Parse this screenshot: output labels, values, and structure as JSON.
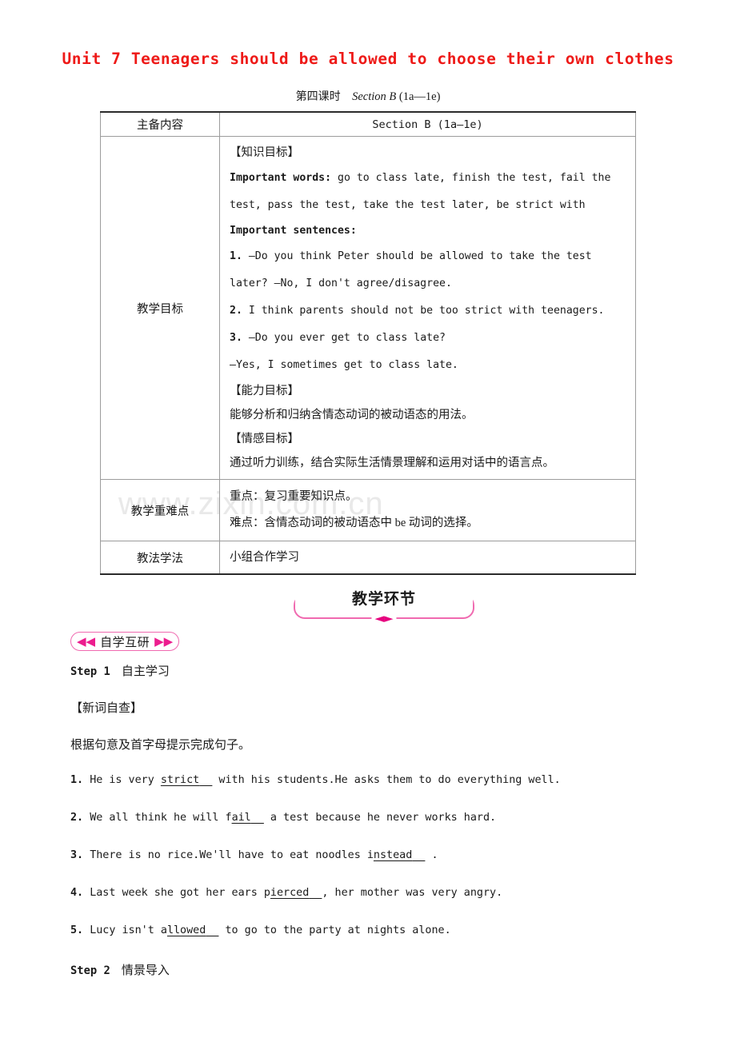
{
  "document": {
    "title": "Unit 7  Teenagers should be allowed to choose their own clothes",
    "period_label": "第四课时",
    "section_italic": "Section B",
    "section_range": "(1a—1e)",
    "watermark": "www.zixin.com.cn"
  },
  "table": {
    "header": {
      "label": "主备内容",
      "value": "Section B (1a—1e)"
    },
    "rows": [
      {
        "label": "教学目标",
        "knowledge_heading": "【知识目标】",
        "important_words_label": "Important words:",
        "important_words_line1": "go to class late, finish the test, fail the",
        "important_words_line2": "test, pass the test, take the test later, be strict with",
        "important_sentences_label": "Important sentences:",
        "sentences": [
          {
            "num": "1.",
            "line1": "—Do you think Peter should be allowed to take the test",
            "line2": "later? —No, I don't agree/disagree."
          },
          {
            "num": "2.",
            "line1": "I think parents should not be too strict with teenagers.",
            "line2": ""
          },
          {
            "num": "3.",
            "line1": "—Do you ever get to class late?",
            "line2": "—Yes, I sometimes get to class late."
          }
        ],
        "ability_heading": "【能力目标】",
        "ability_text": "能够分析和归纳含情态动词的被动语态的用法。",
        "emotion_heading": "【情感目标】",
        "emotion_text": "通过听力训练，结合实际生活情景理解和运用对话中的语言点。"
      },
      {
        "label": "教学重难点",
        "key_point": "重点：复习重要知识点。",
        "difficult_point": "难点：含情态动词的被动语态中 be 动词的选择。"
      },
      {
        "label": "教法学法",
        "value": "小组合作学习"
      }
    ]
  },
  "banner": {
    "label": "教学环节",
    "diamond_icon": "◄►"
  },
  "study_pill": {
    "left_arrow": "◀◀",
    "label": "自学互研",
    "right_arrow": "▶▶"
  },
  "steps": [
    {
      "keyword": "Step 1",
      "title": "自主学习"
    },
    {
      "keyword": "Step 2",
      "title": "情景导入"
    }
  ],
  "new_words": {
    "heading": "【新词自查】",
    "instruction": "根据句意及首字母提示完成句子。",
    "exercises": [
      {
        "num": "1.",
        "before": "He is very ",
        "answer": "strict",
        "after": " with his students.He asks them to do everything well."
      },
      {
        "num": "2.",
        "before": "We all think he will ",
        "prefix": "f",
        "answer": "ail",
        "after": " a test because he never works hard."
      },
      {
        "num": "3.",
        "before": "There is no rice.We'll have to eat noodles ",
        "prefix": "i",
        "answer": "nstead",
        "after": " ."
      },
      {
        "num": "4.",
        "before": "Last week she got her ears ",
        "prefix": "p",
        "answer": "ierced",
        "after": ", her mother was very angry."
      },
      {
        "num": "5.",
        "before": "Lucy isn't a",
        "prefix": "",
        "answer": "llowed",
        "after": " to go to the party at nights alone."
      }
    ]
  },
  "colors": {
    "title_red": "#ee1a18",
    "pink_border": "#f06ab0",
    "magenta_arrow": "#ec1d8e",
    "table_outer": "#2b2b2b",
    "table_inner": "#9c9c9c",
    "watermark_gray": "#e9e9e9"
  }
}
